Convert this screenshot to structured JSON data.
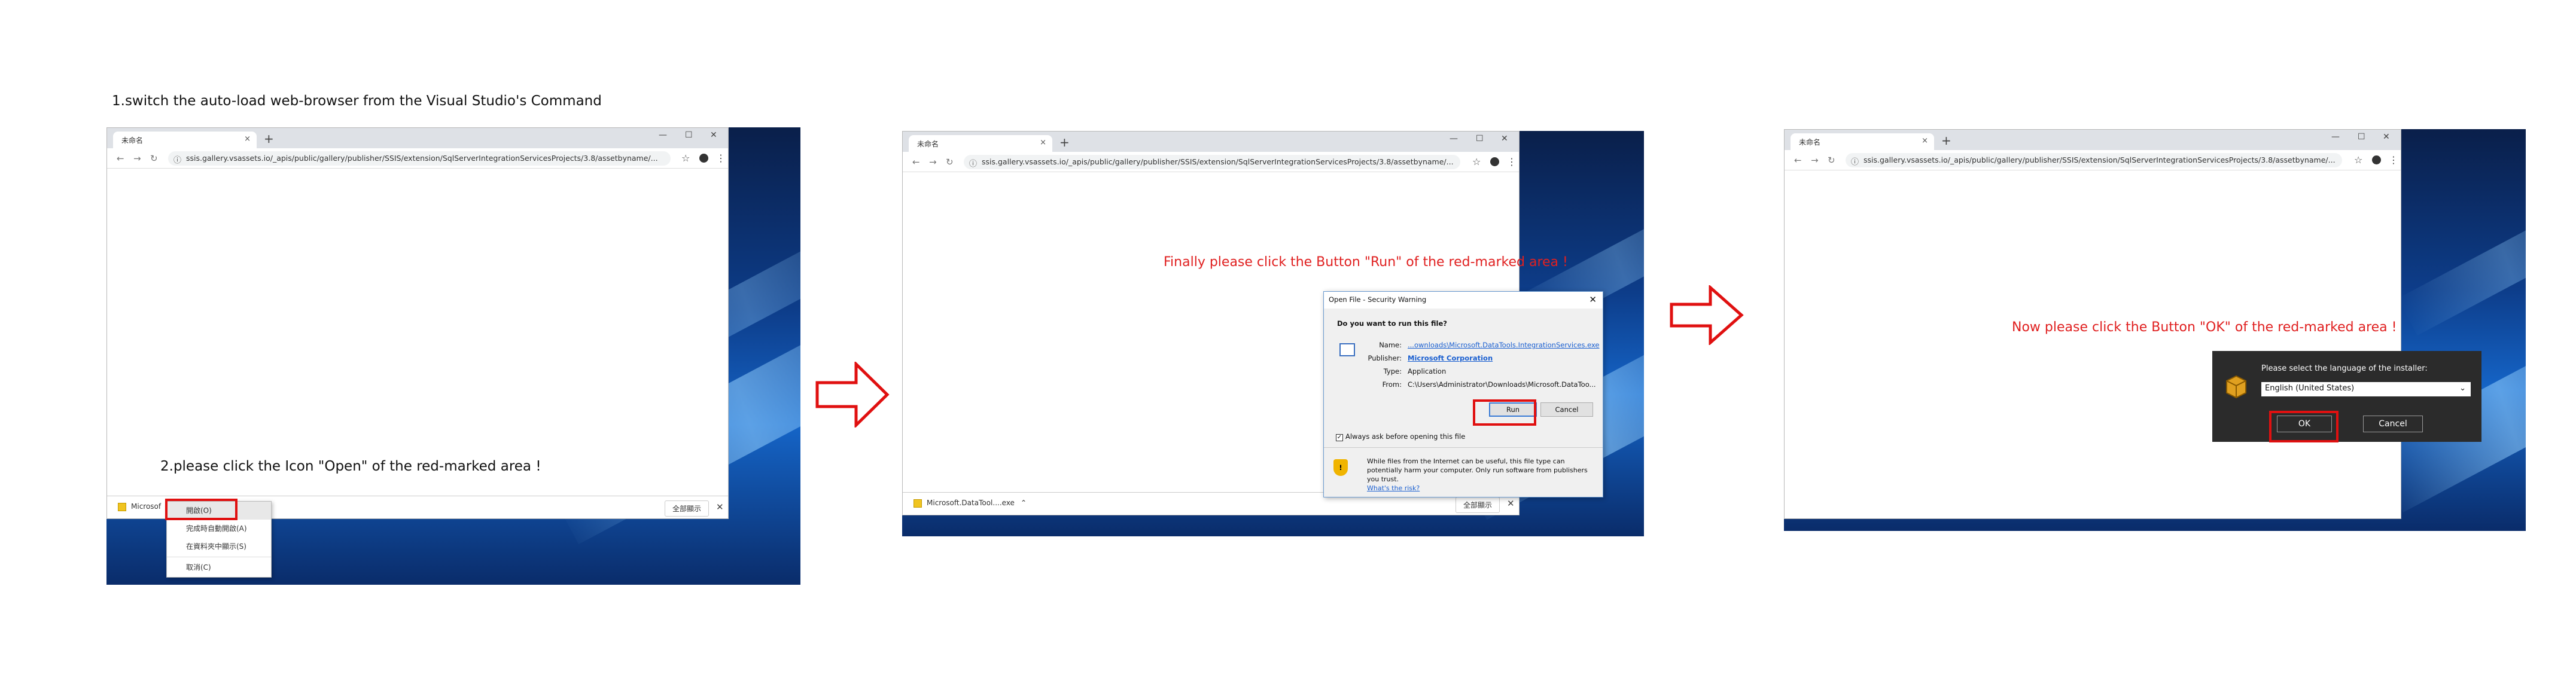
{
  "step1": {
    "caption": "1.switch the auto-load web-browser from the Visual Studio's Command",
    "caption2": "2.please click the Icon \"Open\" of the red-marked area !",
    "context_menu": [
      "開啟(O)",
      "完成時自動開啟(A)",
      "在資料夾中顯示(S)",
      "取消(C)"
    ]
  },
  "step2": {
    "caption": "Finally please click the Button \"Run\" of the red-marked area !",
    "download_name": "Microsoft.DataTool....exe",
    "dialog": {
      "title": "Open File - Security Warning",
      "question": "Do you want to run this file?",
      "name_label": "Name:",
      "name_value": "...ownloads\\Microsoft.DataTools.IntegrationServices.exe",
      "publisher_label": "Publisher:",
      "publisher_value": "Microsoft Corporation",
      "type_label": "Type:",
      "type_value": "Application",
      "from_label": "From:",
      "from_value": "C:\\Users\\Administrator\\Downloads\\Microsoft.DataToo...",
      "run": "Run",
      "cancel": "Cancel",
      "always_ask": "Always ask before opening this file",
      "warning": "While files from the Internet can be useful, this file type can potentially harm your computer. Only run software from publishers you trust.",
      "whats_risk": "What's the risk?"
    }
  },
  "step3": {
    "caption": "Now please click the Button \"OK\" of the red-marked area !",
    "installer": {
      "prompt": "Please select the language of the installer:",
      "language": "English (United States)",
      "ok": "OK",
      "cancel": "Cancel"
    }
  },
  "browser": {
    "tab_title": "未命名",
    "url": "ssis.gallery.vsassets.io/_apis/public/gallery/publisher/SSIS/extension/SqlServerIntegrationServicesProjects/3.8/assetbyname/...",
    "show_all": "全部顯示"
  },
  "icons": {
    "arrow": "right-arrow-outline",
    "shield": "shield-icon",
    "installer": "installer-box-icon"
  },
  "colors": {
    "highlight": "#e01010",
    "caption_red": "#e02020"
  }
}
